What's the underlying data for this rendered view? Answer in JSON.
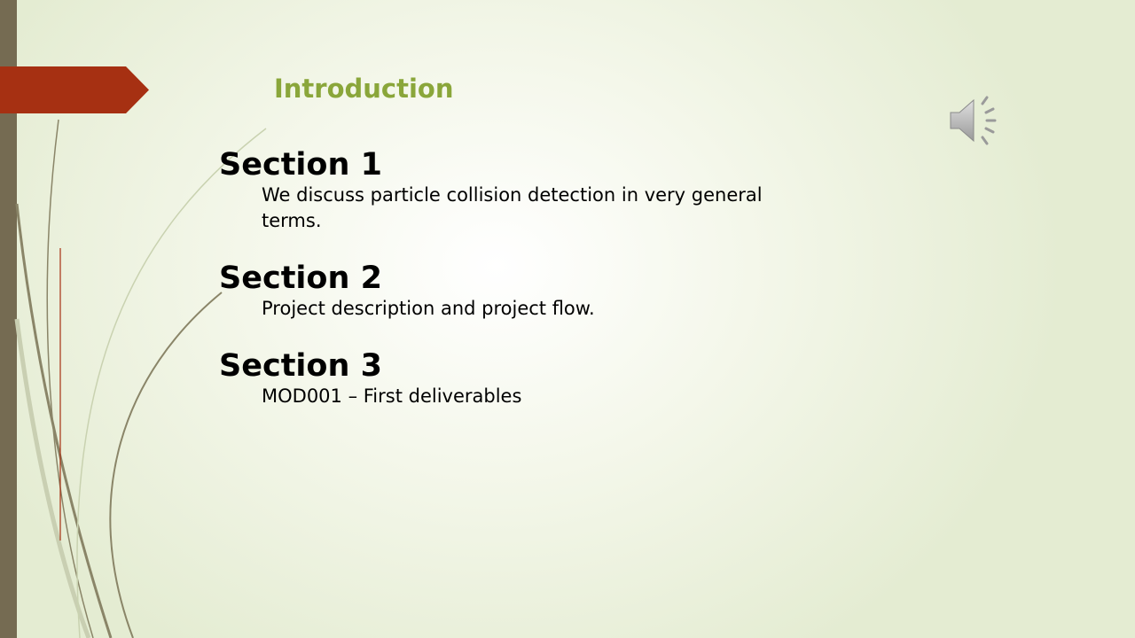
{
  "slide": {
    "title": "Introduction",
    "sections": [
      {
        "heading": "Section 1",
        "body": "We discuss particle collision detection in very general terms."
      },
      {
        "heading": "Section 2",
        "body": "Project description and project flow."
      },
      {
        "heading": "Section 3",
        "body": "MOD001 – First deliverables"
      }
    ]
  },
  "icons": {
    "audio": "speaker-icon"
  },
  "colors": {
    "title": "#8aa63a",
    "accent_arrow": "#a63012",
    "left_bar": "#756b52"
  }
}
